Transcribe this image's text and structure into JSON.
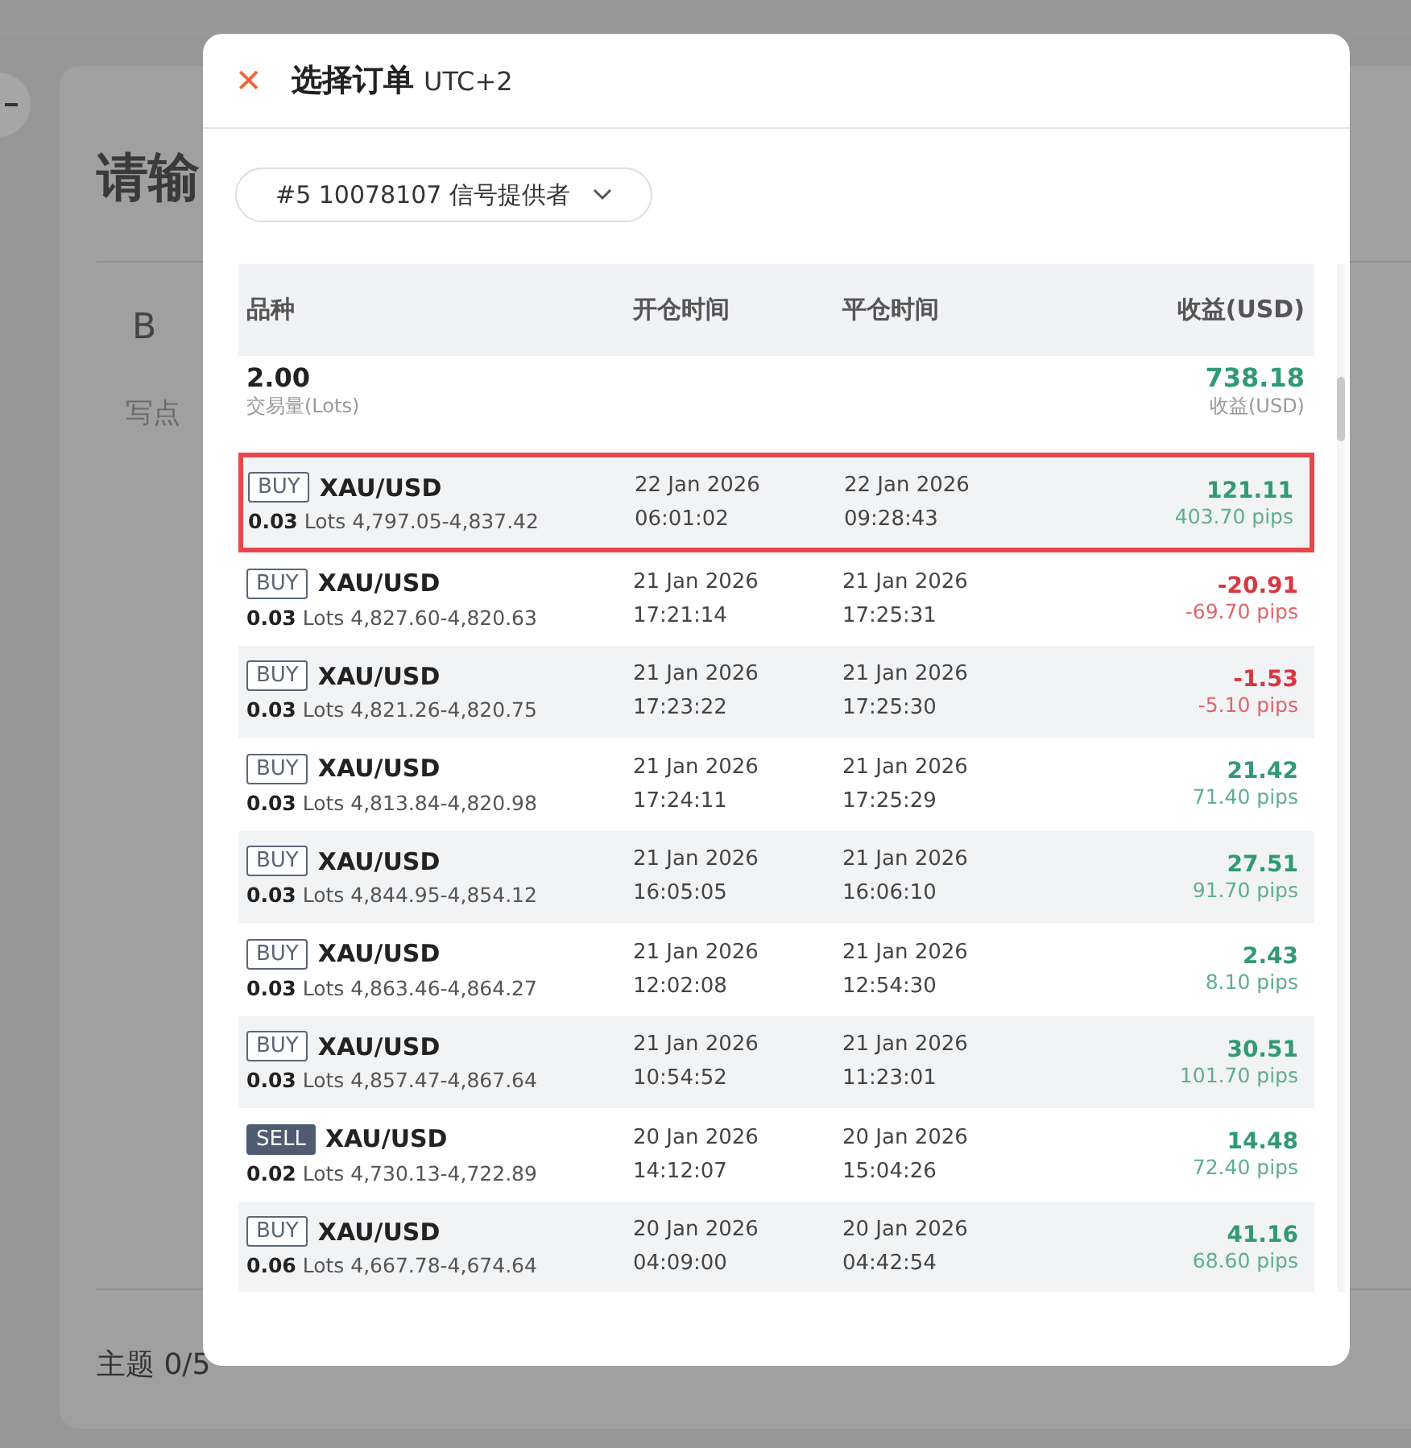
{
  "background_page": {
    "title": "请输",
    "toolbar_button": "B",
    "body_placeholder": "写点",
    "topic_label": "主题 0/5"
  },
  "dialog": {
    "close": "✕",
    "title": "选择订单",
    "timezone": "UTC+2",
    "account_select": "#5 10078107 信号提供者",
    "columns": [
      "品种",
      "开仓时间",
      "平仓时间",
      "收益(USD)"
    ],
    "summary": {
      "volume": "2.00",
      "volume_label": "交易量(Lots)",
      "profit": "738.18",
      "profit_label": "收益(USD)"
    },
    "orders": [
      {
        "side": "BUY",
        "symbol": "XAU/USD",
        "lots": "0.03",
        "lots_unit": "Lots",
        "prices": "4,797.05-4,837.42",
        "open_date": "22 Jan 2026",
        "open_time": "06:01:02",
        "close_date": "22 Jan 2026",
        "close_time": "09:28:43",
        "profit": "121.11",
        "pips": "403.70 pips",
        "positive": true,
        "highlighted": true
      },
      {
        "side": "BUY",
        "symbol": "XAU/USD",
        "lots": "0.03",
        "lots_unit": "Lots",
        "prices": "4,827.60-4,820.63",
        "open_date": "21 Jan 2026",
        "open_time": "17:21:14",
        "close_date": "21 Jan 2026",
        "close_time": "17:25:31",
        "profit": "-20.91",
        "pips": "-69.70 pips",
        "positive": false,
        "highlighted": false
      },
      {
        "side": "BUY",
        "symbol": "XAU/USD",
        "lots": "0.03",
        "lots_unit": "Lots",
        "prices": "4,821.26-4,820.75",
        "open_date": "21 Jan 2026",
        "open_time": "17:23:22",
        "close_date": "21 Jan 2026",
        "close_time": "17:25:30",
        "profit": "-1.53",
        "pips": "-5.10 pips",
        "positive": false,
        "highlighted": false
      },
      {
        "side": "BUY",
        "symbol": "XAU/USD",
        "lots": "0.03",
        "lots_unit": "Lots",
        "prices": "4,813.84-4,820.98",
        "open_date": "21 Jan 2026",
        "open_time": "17:24:11",
        "close_date": "21 Jan 2026",
        "close_time": "17:25:29",
        "profit": "21.42",
        "pips": "71.40 pips",
        "positive": true,
        "highlighted": false
      },
      {
        "side": "BUY",
        "symbol": "XAU/USD",
        "lots": "0.03",
        "lots_unit": "Lots",
        "prices": "4,844.95-4,854.12",
        "open_date": "21 Jan 2026",
        "open_time": "16:05:05",
        "close_date": "21 Jan 2026",
        "close_time": "16:06:10",
        "profit": "27.51",
        "pips": "91.70 pips",
        "positive": true,
        "highlighted": false
      },
      {
        "side": "BUY",
        "symbol": "XAU/USD",
        "lots": "0.03",
        "lots_unit": "Lots",
        "prices": "4,863.46-4,864.27",
        "open_date": "21 Jan 2026",
        "open_time": "12:02:08",
        "close_date": "21 Jan 2026",
        "close_time": "12:54:30",
        "profit": "2.43",
        "pips": "8.10 pips",
        "positive": true,
        "highlighted": false
      },
      {
        "side": "BUY",
        "symbol": "XAU/USD",
        "lots": "0.03",
        "lots_unit": "Lots",
        "prices": "4,857.47-4,867.64",
        "open_date": "21 Jan 2026",
        "open_time": "10:54:52",
        "close_date": "21 Jan 2026",
        "close_time": "11:23:01",
        "profit": "30.51",
        "pips": "101.70 pips",
        "positive": true,
        "highlighted": false
      },
      {
        "side": "SELL",
        "symbol": "XAU/USD",
        "lots": "0.02",
        "lots_unit": "Lots",
        "prices": "4,730.13-4,722.89",
        "open_date": "20 Jan 2026",
        "open_time": "14:12:07",
        "close_date": "20 Jan 2026",
        "close_time": "15:04:26",
        "profit": "14.48",
        "pips": "72.40 pips",
        "positive": true,
        "highlighted": false
      },
      {
        "side": "BUY",
        "symbol": "XAU/USD",
        "lots": "0.06",
        "lots_unit": "Lots",
        "prices": "4,667.78-4,674.64",
        "open_date": "20 Jan 2026",
        "open_time": "04:09:00",
        "close_date": "20 Jan 2026",
        "close_time": "04:42:54",
        "profit": "41.16",
        "pips": "68.60 pips",
        "positive": true,
        "highlighted": false
      }
    ]
  }
}
